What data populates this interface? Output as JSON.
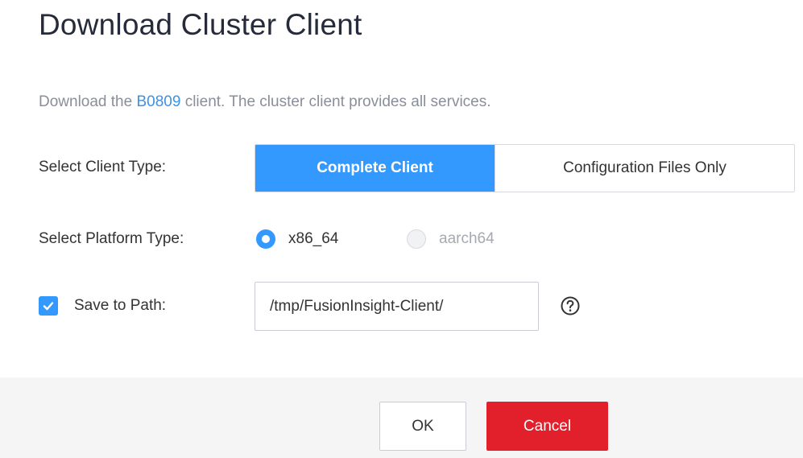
{
  "dialog": {
    "title": "Download Cluster Client",
    "description": {
      "prefix": "Download the ",
      "link": "B0809",
      "suffix": " client. The cluster client provides all services."
    },
    "client_type": {
      "label": "Select Client Type:",
      "options": [
        "Complete Client",
        "Configuration Files Only"
      ],
      "selected": "Complete Client"
    },
    "platform_type": {
      "label": "Select Platform Type:",
      "options": [
        {
          "label": "x86_64",
          "state": "checked"
        },
        {
          "label": "aarch64",
          "state": "disabled"
        }
      ]
    },
    "save_path": {
      "checked": true,
      "label": "Save to Path:",
      "value": "/tmp/FusionInsight-Client/",
      "help_icon": "question-circle-icon"
    },
    "buttons": {
      "ok": "OK",
      "cancel": "Cancel"
    }
  },
  "colors": {
    "accent": "#3399ff",
    "link": "#3d91e6",
    "danger": "#e2202c",
    "footer_bg": "#f5f5f6"
  }
}
